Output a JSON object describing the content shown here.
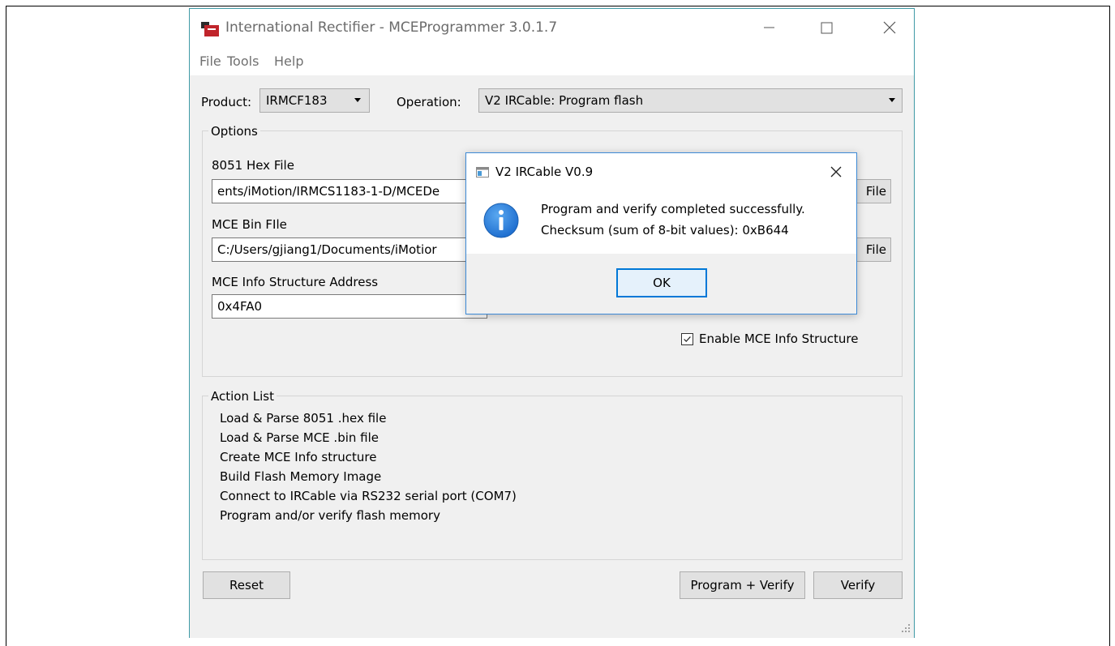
{
  "window": {
    "title": "International Rectifier - MCEProgrammer 3.0.1.7"
  },
  "menu": {
    "file": "File",
    "tools": "Tools",
    "help": "Help"
  },
  "product": {
    "label": "Product:",
    "value": "IRMCF183"
  },
  "operation": {
    "label": "Operation:",
    "value": "V2 IRCable: Program flash"
  },
  "options": {
    "title": "Options",
    "hex_file": {
      "label": "8051 Hex File",
      "value": "ents/iMotion/IRMCS1183-1-D/MCEDe",
      "button": "File"
    },
    "bin_file": {
      "label": "MCE Bin FIle",
      "value": "C:/Users/gjiang1/Documents/iMotior",
      "button": "File"
    },
    "info_address": {
      "label": "MCE Info Structure Address",
      "value": "0x4FA0"
    },
    "enable_info": {
      "label": "Enable MCE Info Structure",
      "checked": true
    }
  },
  "action_list": {
    "title": "Action List",
    "items": [
      "Load & Parse 8051 .hex file",
      "Load & Parse MCE .bin file",
      "Create MCE Info structure",
      "Build Flash Memory Image",
      "Connect to IRCable via RS232 serial port (COM7)",
      "Program and/or verify flash memory"
    ]
  },
  "buttons": {
    "reset": "Reset",
    "program_verify": "Program + Verify",
    "verify": "Verify"
  },
  "dialog": {
    "title": "V2 IRCable V0.9",
    "message_line1": "Program and verify completed successfully.",
    "message_line2": "Checksum (sum of 8-bit values): 0xB644",
    "ok": "OK"
  },
  "colors": {
    "window_border": "#3f9aa6",
    "dialog_border": "#3d8ad6",
    "ok_focus": "#0078d7",
    "info_icon": "#1f6fd0",
    "app_icon_red": "#c0242b"
  },
  "icons": {
    "app": "app-logo-icon",
    "dialog": "dialog-window-icon",
    "info": "info-icon"
  }
}
